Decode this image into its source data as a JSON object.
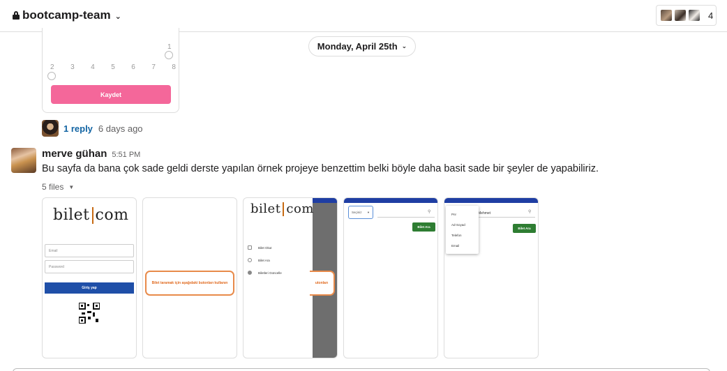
{
  "header": {
    "channel_name": "bootcamp-team",
    "member_count": "4"
  },
  "date_divider": "Monday, April 25th",
  "previous_attachment": {
    "scale_labels": [
      "2",
      "3",
      "4",
      "5",
      "6",
      "7",
      "8"
    ],
    "scale_top_label": "1",
    "button_label": "Kaydet",
    "button_color": "#f4679a"
  },
  "thread": {
    "reply_label": "1 reply",
    "reply_time": "6 days ago"
  },
  "message": {
    "author": "merve gühan",
    "time": "5:51 PM",
    "text": "Bu sayfa da bana çok sade geldi derste yapılan örnek projeye benzettim belki böyle daha basit sade bir şeyler de yapabiliriz.",
    "files_label": "5 files"
  },
  "files": {
    "login": {
      "logo_left": "bilet",
      "logo_right": "com",
      "email_placeholder": "Email",
      "password_placeholder": "Password",
      "login_button": "Giriş yap"
    },
    "scan": {
      "instruction": "Bilet taramak için aşağıdaki butonları kullanın"
    },
    "drawer": {
      "logo_left": "bilet",
      "logo_right": "com",
      "menu_items": [
        "Bilet Okut",
        "Bilet Ara",
        "Biletleri Güncelle"
      ],
      "partial_text": "utonları"
    },
    "search": {
      "select_value": "Seçiniz",
      "button": "Bilet Ara"
    },
    "search_dropdown": {
      "options": [
        "Pnr",
        "Ad-Soyad",
        "Telefon",
        "Email"
      ],
      "search_value": "Mehmet",
      "button": "Bilet Ara"
    }
  },
  "colors": {
    "link": "#1264a3",
    "app_blue": "#1f4fa8",
    "app_orange": "#e88a4a",
    "app_green": "#2e7d32"
  }
}
